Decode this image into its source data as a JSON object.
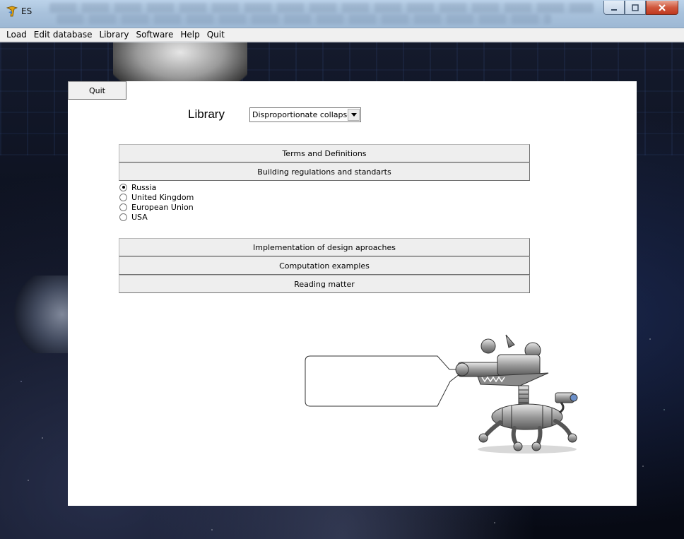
{
  "window": {
    "title": "ES",
    "icon": "app-logo-icon",
    "controls": [
      "minimize-icon",
      "maximize-icon",
      "close-icon"
    ]
  },
  "menu": {
    "items": [
      {
        "label": "Load"
      },
      {
        "label": "Edit database"
      },
      {
        "label": "Library"
      },
      {
        "label": "Software"
      },
      {
        "label": "Help"
      },
      {
        "label": "Quit"
      }
    ]
  },
  "panel": {
    "quit_label": "Quit",
    "library_label": "Library",
    "library_select": {
      "value": "Disproportionate collapse",
      "icon": "dropdown-arrow-icon"
    },
    "sections_top": [
      {
        "label": "Terms and Definitions"
      },
      {
        "label": "Building regulations and standarts"
      }
    ],
    "regions": [
      {
        "label": "Russia",
        "checked": true
      },
      {
        "label": "United Kingdom",
        "checked": false
      },
      {
        "label": "European Union",
        "checked": false
      },
      {
        "label": "USA",
        "checked": false
      }
    ],
    "sections_bottom": [
      {
        "label": "Implementation of design aproaches"
      },
      {
        "label": "Computation examples"
      },
      {
        "label": "Reading matter"
      }
    ],
    "assistant": {
      "bubble_text": "",
      "image": "robot-dog-illustration"
    }
  },
  "colors": {
    "panel_bg": "#ffffff",
    "button_bg": "#eeeeee",
    "titlebar": "#a9c2dc",
    "close_button": "#c0391f"
  }
}
